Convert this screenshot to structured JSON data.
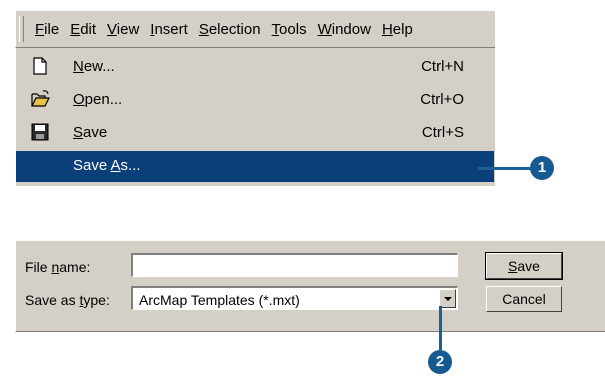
{
  "menu_bar": {
    "items": [
      {
        "pre": "",
        "u": "F",
        "post": "ile"
      },
      {
        "pre": "",
        "u": "E",
        "post": "dit"
      },
      {
        "pre": "",
        "u": "V",
        "post": "iew"
      },
      {
        "pre": "",
        "u": "I",
        "post": "nsert"
      },
      {
        "pre": "",
        "u": "S",
        "post": "election"
      },
      {
        "pre": "",
        "u": "T",
        "post": "ools"
      },
      {
        "pre": "",
        "u": "W",
        "post": "indow"
      },
      {
        "pre": "",
        "u": "H",
        "post": "elp"
      }
    ]
  },
  "file_menu": {
    "items": [
      {
        "pre": "",
        "u": "N",
        "post": "ew...",
        "shortcut": "Ctrl+N",
        "icon": "new-document-icon"
      },
      {
        "pre": "",
        "u": "O",
        "post": "pen...",
        "shortcut": "Ctrl+O",
        "icon": "open-folder-icon"
      },
      {
        "pre": "",
        "u": "S",
        "post": "ave",
        "shortcut": "Ctrl+S",
        "icon": "save-disk-icon"
      },
      {
        "pre": "Save ",
        "u": "A",
        "post": "s...",
        "shortcut": "",
        "icon": ""
      }
    ],
    "selected_index": 3
  },
  "callouts": {
    "one": "1",
    "two": "2"
  },
  "dialog": {
    "file_name_label": {
      "pre": "File ",
      "u": "n",
      "post": "ame:"
    },
    "file_name_value": "",
    "save_type_label": {
      "pre": "Save as ",
      "u": "t",
      "post": "ype:"
    },
    "save_type_value": "ArcMap Templates (*.mxt)",
    "save_button": {
      "pre": "",
      "u": "S",
      "post": "ave"
    },
    "cancel_button": "Cancel"
  },
  "colors": {
    "menu_bg": "#d4d0c8",
    "selection": "#0a3f7a",
    "callout": "#175a91"
  }
}
